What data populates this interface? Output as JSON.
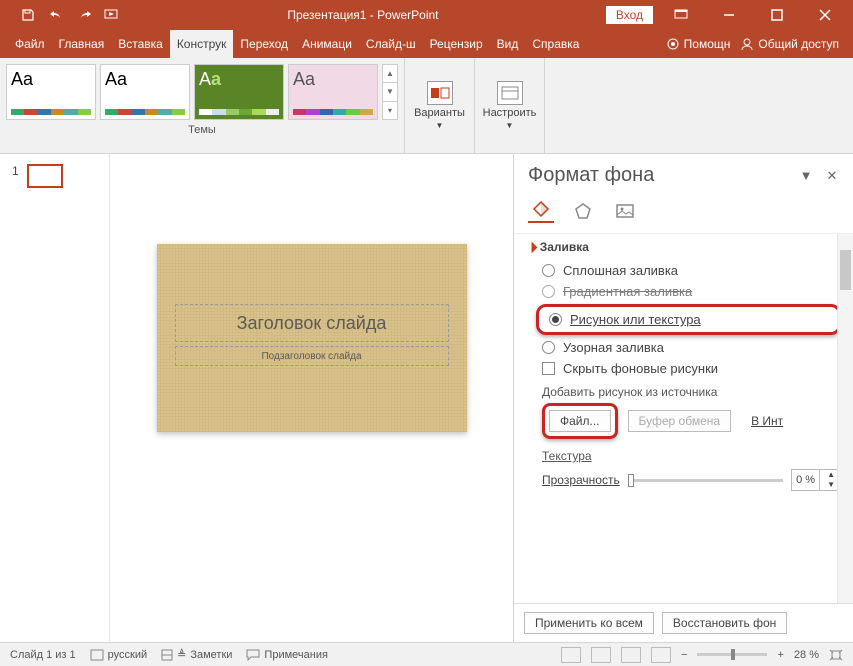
{
  "title": "Презентация1 - PowerPoint",
  "login": "Вход",
  "tabs": [
    "Файл",
    "Главная",
    "Вставка",
    "Конструк",
    "Переход",
    "Анимаци",
    "Слайд-ш",
    "Рецензир",
    "Вид",
    "Справка"
  ],
  "help": "Помощн",
  "share": "Общий доступ",
  "ribbon": {
    "themes_label": "Темы",
    "variants": "Варианты",
    "customize": "Настроить"
  },
  "thumb_index": "1",
  "slide": {
    "title_ph": "Заголовок слайда",
    "sub_ph": "Подзаголовок слайда"
  },
  "pane": {
    "title": "Формат фона",
    "section": "Заливка",
    "opt_solid": "Сплошная заливка",
    "opt_grad": "Градиентная заливка",
    "opt_pic": "Рисунок или текстура",
    "opt_pattern": "Узорная заливка",
    "opt_hidebg": "Скрыть фоновые рисунки",
    "insert_from": "Добавить рисунок из источника",
    "btn_file": "Файл...",
    "btn_clip": "Буфер обмена",
    "btn_web": "В Инт",
    "texture": "Текстура",
    "transparency": "Прозрачность",
    "trans_val": "0 %",
    "apply_all": "Применить ко всем",
    "reset": "Восстановить фон"
  },
  "status": {
    "slide": "Слайд 1 из 1",
    "lang": "русский",
    "notes": "Заметки",
    "comments": "Примечания",
    "zoom": "28 %"
  }
}
